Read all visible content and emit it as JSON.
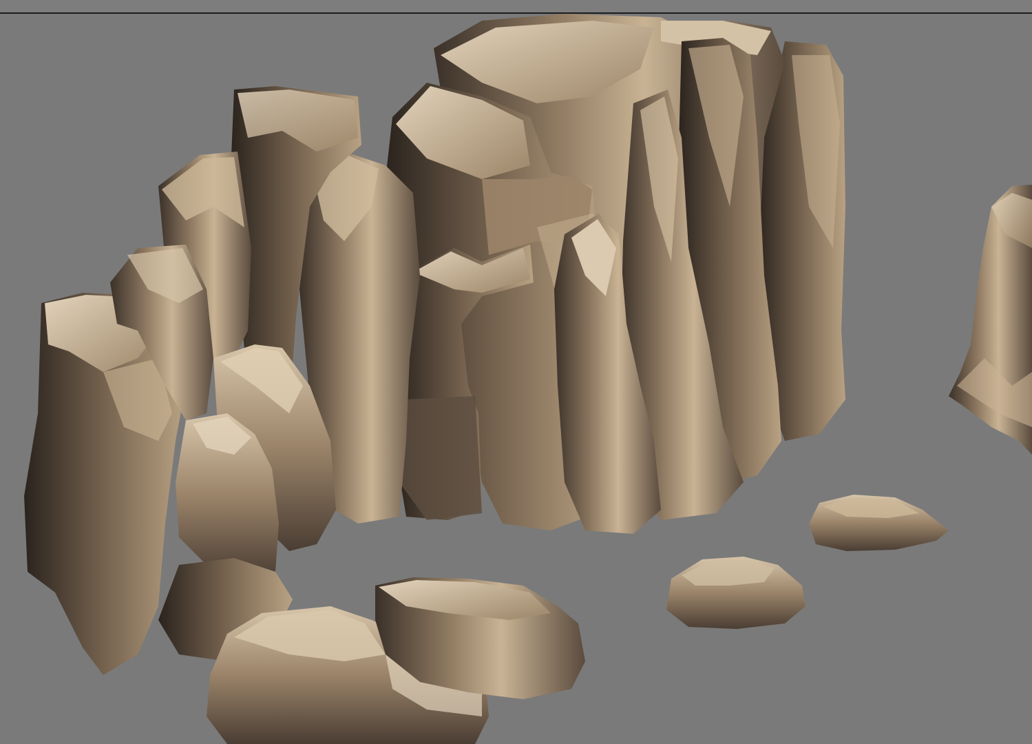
{
  "viewport": {
    "background": "#7a7a7a",
    "top_bar_color": "#7d7d7d",
    "top_bar_line": "#1c1c1c"
  },
  "scene": {
    "subject": "3d-rock-formations",
    "palette": {
      "highlight": "#c9b394",
      "midtone": "#8f7a62",
      "shadow": "#3b3129",
      "deep_shadow": "#241e19",
      "light_band": "#e2d3bb"
    }
  }
}
